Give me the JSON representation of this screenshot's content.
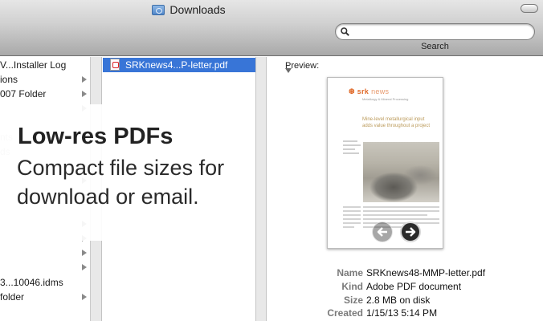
{
  "window": {
    "title": "Downloads",
    "title_icon": "folder-icon"
  },
  "search": {
    "label": "Search",
    "placeholder": "",
    "value": ""
  },
  "column1": {
    "items": [
      {
        "label": "V...Installer Log",
        "has_children": false
      },
      {
        "label": "ions",
        "has_children": true
      },
      {
        "label": "007 Folder",
        "has_children": true
      },
      {
        "label": "",
        "has_children": true
      },
      {
        "label": "nts",
        "has_children": false
      },
      {
        "label": "ds",
        "has_children": false
      },
      {
        "label": "",
        "has_children": true
      },
      {
        "label": "",
        "has_children": true
      },
      {
        "label": "",
        "has_children": true
      },
      {
        "label": "",
        "has_children": true
      },
      {
        "label": "",
        "has_children": true
      },
      {
        "label": "",
        "has_children": true
      },
      {
        "label": "",
        "has_children": true
      },
      {
        "label": "3...10046.idms",
        "has_children": false
      },
      {
        "label": "folder",
        "has_children": true
      }
    ]
  },
  "column2": {
    "selected_file": "SRKnews4...P-letter.pdf",
    "file_icon": "pdf-file-icon"
  },
  "preview": {
    "heading": "Preview:",
    "thumbnail": {
      "logo": "srk",
      "logo_suffix": "news",
      "subtitle": "Metallurgy & Mineral Processing",
      "headline_line1": "Mine-level metallurgical input",
      "headline_line2": "adds value throughout a project"
    },
    "info": [
      {
        "key": "Name",
        "value": "SRKnews48-MMP-letter.pdf"
      },
      {
        "key": "Kind",
        "value": "Adobe PDF document"
      },
      {
        "key": "Size",
        "value": "2.8 MB on disk"
      },
      {
        "key": "Created",
        "value": "1/15/13 5:14 PM"
      }
    ]
  },
  "overlay": {
    "title": "Low-res PDFs",
    "line1": "Compact file sizes for",
    "line2": "download or email."
  },
  "colors": {
    "selection": "#3875d7",
    "toolbar_top": "#e6e6e6",
    "toolbar_bottom": "#a9a9a9",
    "brand_orange": "#e06b2b"
  }
}
